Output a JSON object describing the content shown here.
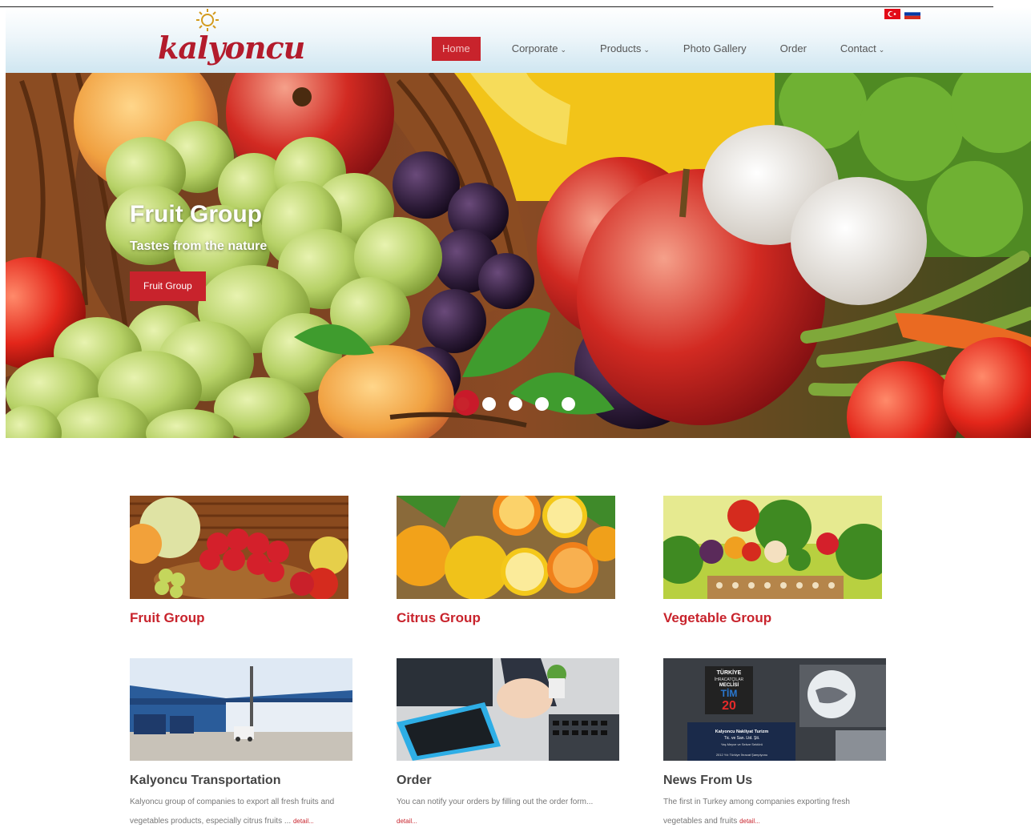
{
  "brand": {
    "name": "kalyoncu"
  },
  "languages": [
    {
      "name": "Turkish",
      "icon": "turkey-flag-icon",
      "color": "#e30a17"
    },
    {
      "name": "Russian",
      "icon": "russia-flag-icon",
      "colors": [
        "#ffffff",
        "#0039a6",
        "#d52b1e"
      ]
    }
  ],
  "nav": {
    "home": "Home",
    "corporate": "Corporate",
    "products": "Products",
    "gallery": "Photo Gallery",
    "order": "Order",
    "contact": "Contact",
    "dropdown_icon": "chevron-down-icon"
  },
  "hero": {
    "title": "Fruit Group",
    "subtitle": "Tastes from the nature",
    "button": "Fruit Group",
    "slides": 5,
    "active_slide": 1
  },
  "categories": [
    {
      "title": "Fruit Group"
    },
    {
      "title": "Citrus Group"
    },
    {
      "title": "Vegetable Group"
    }
  ],
  "news": [
    {
      "title": "Kalyoncu Transportation",
      "line1": "Kalyoncu group of companies to export all fresh fruits and",
      "line2": "vegetables products, especially citrus fruits ...",
      "detail": "detail..."
    },
    {
      "title": "Order",
      "line1": "You can notify your orders by filling out the order form...",
      "detail": "detail..."
    },
    {
      "title": "News From Us",
      "line1": "The first in Turkey among companies exporting fresh",
      "line2": "vegetables and fruits",
      "detail": "detail..."
    }
  ],
  "award_plaque": [
    "TÜRKİYE",
    "İHRACATÇILAR",
    "MECLİSİ",
    "TİM",
    "20",
    "Kalyoncu Nakliyat Turizm",
    "Tic. ve San. Ltd. Şti.",
    "Yaş Meyve ve Sebze Sektörü",
    "2012 Yılı Türkiye İhracat Şampiyonu"
  ],
  "colors": {
    "accent": "#c8232c",
    "header_bg": "#dcedf5",
    "dot": "#ffffff"
  }
}
